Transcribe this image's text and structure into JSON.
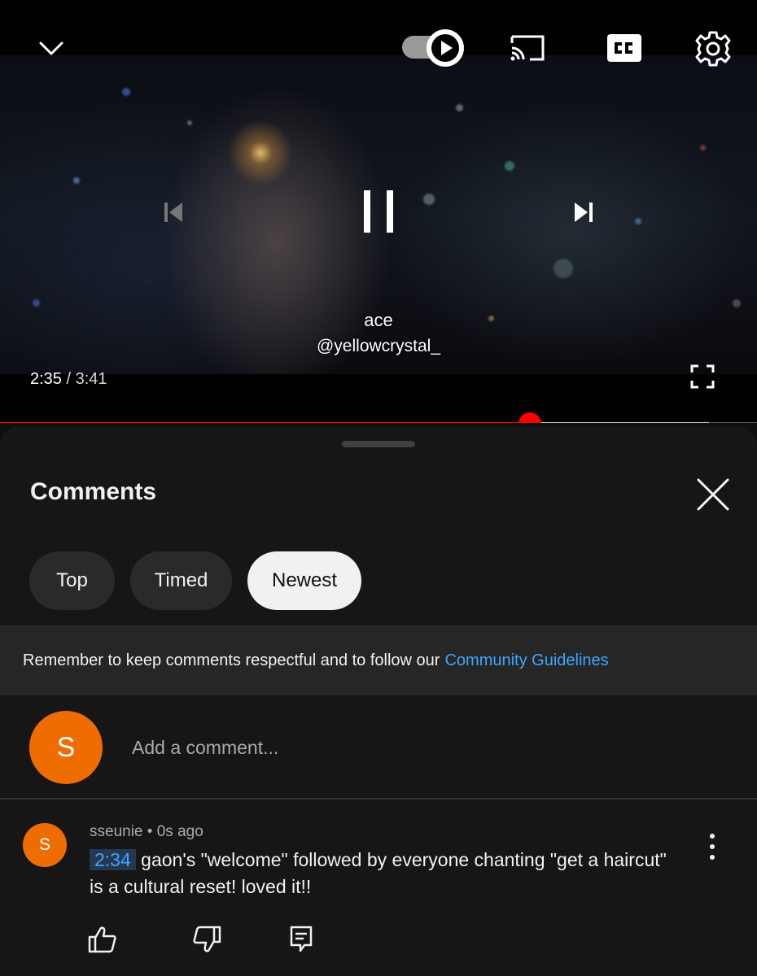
{
  "player": {
    "overlay_title": "ace",
    "overlay_handle": "@yellowcrystal_",
    "current_time": "2:35",
    "time_separator": " / ",
    "duration": "3:41",
    "progress_played": 0.7,
    "progress_buffered": 0.937,
    "autoplay": "on",
    "icons": {
      "collapse": "chevron-down-icon",
      "autoplay": "play-icon",
      "cast": "cast-icon",
      "captions": "cc-icon",
      "settings": "gear-icon",
      "previous": "skip-previous-icon",
      "pause": "pause-icon",
      "next": "skip-next-icon",
      "fullscreen": "fullscreen-icon"
    }
  },
  "comments_panel": {
    "title": "Comments",
    "close_icon": "close-icon",
    "chips": [
      {
        "label": "Top",
        "selected": false
      },
      {
        "label": "Timed",
        "selected": false
      },
      {
        "label": "Newest",
        "selected": true
      }
    ],
    "notice": {
      "text": "Remember to keep comments respectful and to follow our",
      "link": "Community Guidelines"
    },
    "add_comment": {
      "avatar_letter": "S",
      "placeholder": "Add a comment..."
    },
    "comments": [
      {
        "avatar_letter": "S",
        "author": "sseunie",
        "separator": "•",
        "time_ago": "0s ago",
        "timestamp_link": "2:34",
        "text": "gaon's \"welcome\" followed by everyone chanting \"get a haircut\" is a cultural reset! loved it!!"
      }
    ]
  },
  "colors": {
    "accent_red": "#ff0000",
    "avatar_orange": "#ef6c00",
    "link_blue": "#3ea6ff",
    "background": "#0f0f0f",
    "sheet": "#161616"
  }
}
